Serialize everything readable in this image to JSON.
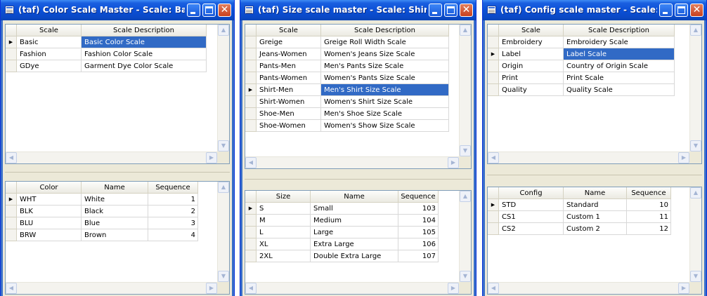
{
  "windows": [
    {
      "title": "(taf) Color Scale Master - Scale: Basic, ...",
      "top": {
        "headers": [
          "Scale",
          "Scale Description"
        ],
        "rows": [
          [
            "Basic",
            "Basic Color Scale"
          ],
          [
            "Fashion",
            "Fashion Color Scale"
          ],
          [
            "GDye",
            "Garment Dye Color Scale"
          ]
        ],
        "current_row": 0,
        "selected_col": 1
      },
      "bottom": {
        "headers": [
          "Color",
          "Name",
          "Sequence"
        ],
        "rows": [
          [
            "WHT",
            "White",
            "1"
          ],
          [
            "BLK",
            "Black",
            "2"
          ],
          [
            "BLU",
            "Blue",
            "3"
          ],
          [
            "BRW",
            "Brown",
            "4"
          ]
        ],
        "current_row": 0
      }
    },
    {
      "title": "(taf) Size scale master - Scale: Shirt-Me...",
      "top": {
        "headers": [
          "Scale",
          "Scale Description"
        ],
        "rows": [
          [
            "Greige",
            "Greige Roll Width Scale"
          ],
          [
            "Jeans-Women",
            "Women's Jeans Size Scale"
          ],
          [
            "Pants-Men",
            "Men's Pants Size Scale"
          ],
          [
            "Pants-Women",
            "Women's Pants Size Scale"
          ],
          [
            "Shirt-Men",
            "Men's Shirt Size Scale"
          ],
          [
            "Shirt-Women",
            "Women's Shirt Size Scale"
          ],
          [
            "Shoe-Men",
            "Men's Shoe Size Scale"
          ],
          [
            "Shoe-Women",
            "Women's Show Size Scale"
          ]
        ],
        "current_row": 4,
        "selected_col": 1
      },
      "bottom": {
        "headers": [
          "Size",
          "Name",
          "Sequence"
        ],
        "rows": [
          [
            "S",
            "Small",
            "103"
          ],
          [
            "M",
            "Medium",
            "104"
          ],
          [
            "L",
            "Large",
            "105"
          ],
          [
            "XL",
            "Extra Large",
            "106"
          ],
          [
            "2XL",
            "Double Extra Large",
            "107"
          ]
        ],
        "current_row": 0
      }
    },
    {
      "title": "(taf) Config scale master - Scale: Label,...",
      "top": {
        "headers": [
          "Scale",
          "Scale Description"
        ],
        "rows": [
          [
            "Embroidery",
            "Embroidery Scale"
          ],
          [
            "Label",
            "Label Scale"
          ],
          [
            "Origin",
            "Country of Origin Scale"
          ],
          [
            "Print",
            "Print Scale"
          ],
          [
            "Quality",
            "Quality Scale"
          ]
        ],
        "current_row": 1,
        "selected_col": 1
      },
      "bottom": {
        "headers": [
          "Config",
          "Name",
          "Sequence"
        ],
        "rows": [
          [
            "STD",
            "Standard",
            "10"
          ],
          [
            "CS1",
            "Custom 1",
            "11"
          ],
          [
            "CS2",
            "Custom 2",
            "12"
          ]
        ],
        "current_row": 0
      }
    }
  ],
  "colors": {
    "titlebar": "#0a48c6",
    "selection": "#316ac5",
    "client": "#ece9d8",
    "close_button": "#c8401e"
  },
  "icons": {
    "window": "form-icon",
    "minimize": "minimize-icon",
    "maximize": "maximize-icon",
    "close": "close-icon",
    "row_indicator": "current-row-arrow-icon"
  }
}
